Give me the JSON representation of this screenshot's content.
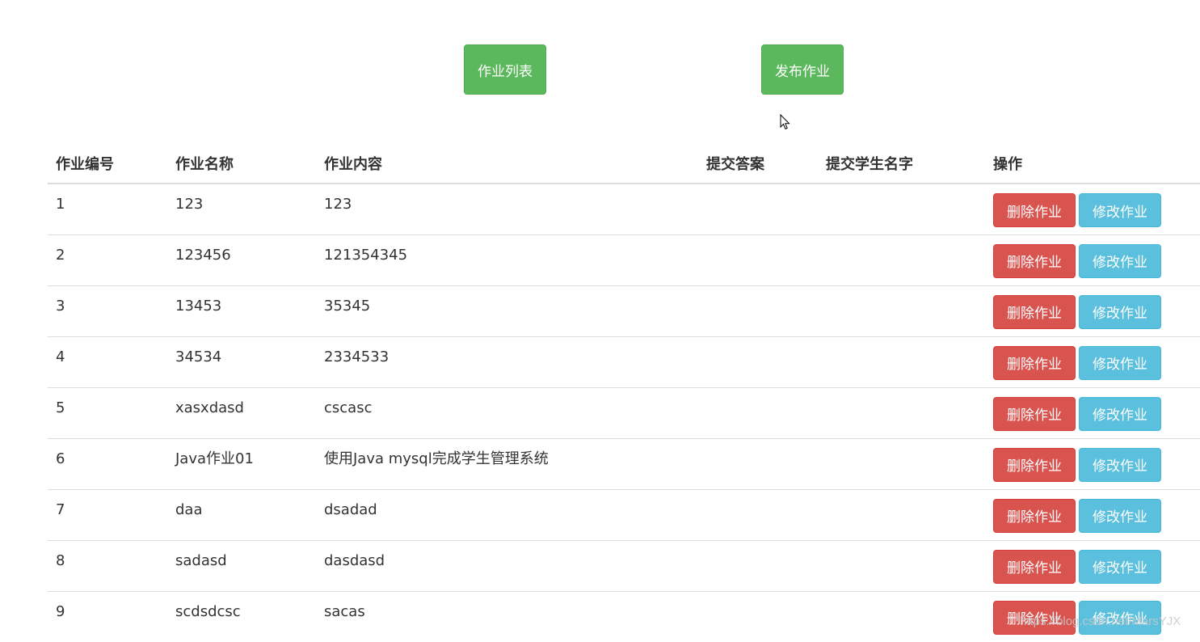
{
  "top_buttons": {
    "list_label": "作业列表",
    "publish_label": "发布作业"
  },
  "table": {
    "headers": {
      "id": "作业编号",
      "name": "作业名称",
      "content": "作业内容",
      "answer": "提交答案",
      "student": "提交学生名字",
      "ops": "操作"
    },
    "rows": [
      {
        "id": "1",
        "name": "123",
        "content": "123",
        "answer": "",
        "student": ""
      },
      {
        "id": "2",
        "name": "123456",
        "content": "121354345",
        "answer": "",
        "student": ""
      },
      {
        "id": "3",
        "name": "13453",
        "content": "35345",
        "answer": "",
        "student": ""
      },
      {
        "id": "4",
        "name": "34534",
        "content": "2334533",
        "answer": "",
        "student": ""
      },
      {
        "id": "5",
        "name": "xasxdasd",
        "content": "cscasc",
        "answer": "",
        "student": ""
      },
      {
        "id": "6",
        "name": "Java作业01",
        "content": "使用Java mysql完成学生管理系统",
        "answer": "",
        "student": ""
      },
      {
        "id": "7",
        "name": "daa",
        "content": "dsadad",
        "answer": "",
        "student": ""
      },
      {
        "id": "8",
        "name": "sadasd",
        "content": "dasdasd",
        "answer": "",
        "student": ""
      },
      {
        "id": "9",
        "name": "scdsdcsc",
        "content": "sacas",
        "answer": "",
        "student": ""
      }
    ],
    "delete_label": "删除作业",
    "edit_label": "修改作业"
  },
  "watermark": "https://blog.csdn.net/MarsYJX",
  "colors": {
    "success": "#5cb85c",
    "danger": "#d9534f",
    "info": "#5bc0de"
  },
  "icons": {
    "cursor": "mouse-pointer-icon"
  }
}
